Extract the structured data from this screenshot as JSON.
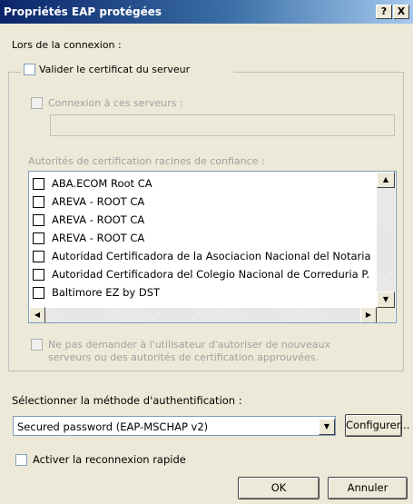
{
  "window": {
    "title": "Propriétés EAP protégées",
    "help_button": "?",
    "close_button": "X"
  },
  "connection": {
    "section_label": "Lors de la connexion :",
    "validate_cert_label": "Valider le certificat du serveur",
    "connect_servers_label": "Connexion à ces serveurs :",
    "servers_value": "",
    "root_ca_label": "Autorités de certification racines de confiance :",
    "ca_list": [
      "ABA.ECOM Root CA",
      "AREVA - ROOT CA",
      "AREVA - ROOT CA",
      "AREVA - ROOT CA",
      "Autoridad Certificadora de la Asociacion Nacional del Notaria",
      "Autoridad Certificadora del Colegio Nacional de Correduria P.",
      "Baltimore EZ by DST"
    ],
    "no_prompt_label_line1": "Ne pas demander à l'utilisateur d'autoriser de nouveaux",
    "no_prompt_label_line2": "serveurs ou des autorités de certification approuvées."
  },
  "auth": {
    "method_label": "Sélectionner la méthode d'authentification :",
    "selected_method": "Secured password (EAP-MSCHAP v2)",
    "configure_button": "Configurer...",
    "fast_reconnect_label": "Activer la reconnexion rapide"
  },
  "footer": {
    "ok_button": "OK",
    "cancel_button": "Annuler"
  },
  "scroll_icons": {
    "up": "▲",
    "down": "▼",
    "left": "◀",
    "right": "▶",
    "combo": "▼"
  }
}
